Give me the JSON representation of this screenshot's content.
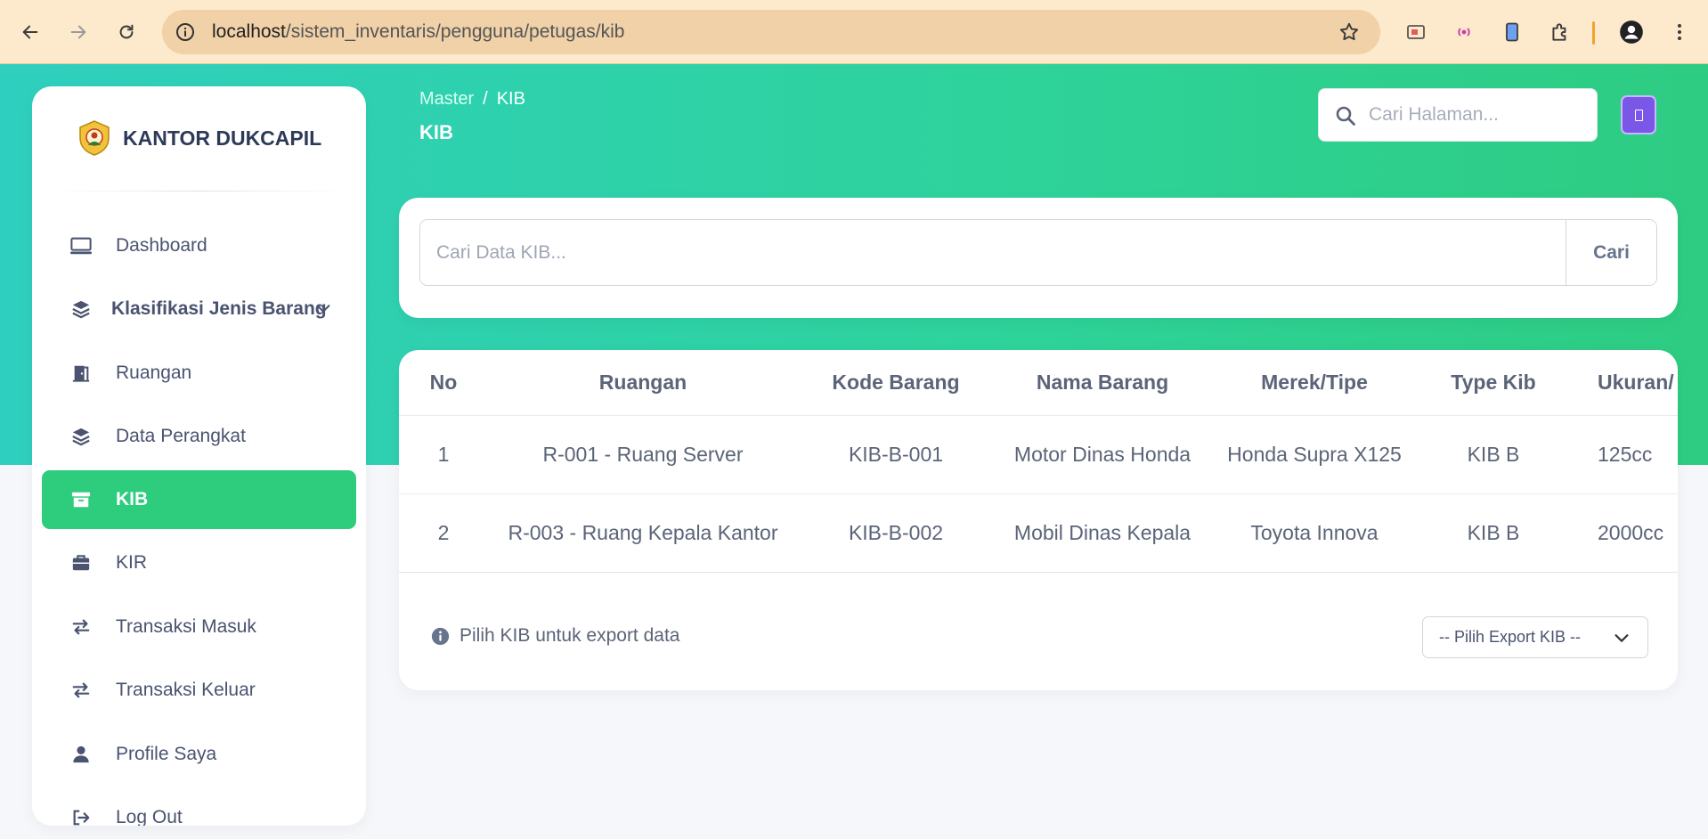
{
  "browser": {
    "url_host": "localhost",
    "url_path": "/sistem_inventaris/pengguna/petugas/kib"
  },
  "brand": {
    "name": "KANTOR DUKCAPIL"
  },
  "sidebar": {
    "items": [
      {
        "label": "Dashboard",
        "icon": "monitor-icon"
      },
      {
        "label": "Klasifikasi Jenis Barang",
        "icon": "layers-icon"
      },
      {
        "label": "Ruangan",
        "icon": "door-icon"
      },
      {
        "label": "Data Perangkat",
        "icon": "layers-icon"
      },
      {
        "label": "KIB",
        "icon": "archive-icon",
        "active": true
      },
      {
        "label": "KIR",
        "icon": "briefcase-icon"
      },
      {
        "label": "Transaksi Masuk",
        "icon": "exchange-icon"
      },
      {
        "label": "Transaksi Keluar",
        "icon": "exchange-icon"
      },
      {
        "label": "Profile Saya",
        "icon": "user-icon"
      },
      {
        "label": "Log Out",
        "icon": "logout-icon"
      }
    ]
  },
  "header": {
    "breadcrumb_parent": "Master",
    "breadcrumb_sep": "/",
    "breadcrumb_current": "KIB",
    "title": "KIB",
    "search_placeholder": "Cari Halaman..."
  },
  "kib_search": {
    "placeholder": "Cari Data KIB...",
    "button_label": "Cari"
  },
  "table": {
    "columns": [
      "No",
      "Ruangan",
      "Kode Barang",
      "Nama Barang",
      "Merek/Tipe",
      "Type Kib",
      "Ukuran/"
    ],
    "rows": [
      [
        "1",
        "R-001 - Ruang Server",
        "KIB-B-001",
        "Motor Dinas Honda",
        "Honda Supra X125",
        "KIB B",
        "125cc"
      ],
      [
        "2",
        "R-003 - Ruang Kepala Kantor",
        "KIB-B-002",
        "Mobil Dinas Kepala",
        "Toyota Innova",
        "KIB B",
        "2000cc"
      ]
    ]
  },
  "footer": {
    "hint": "Pilih KIB untuk export data",
    "export_selected": "-- Pilih Export KIB --"
  },
  "colors": {
    "accent": "#2ecc7d",
    "header_gradient_start": "#2fcfbf",
    "menu_button": "#7b57e8"
  }
}
